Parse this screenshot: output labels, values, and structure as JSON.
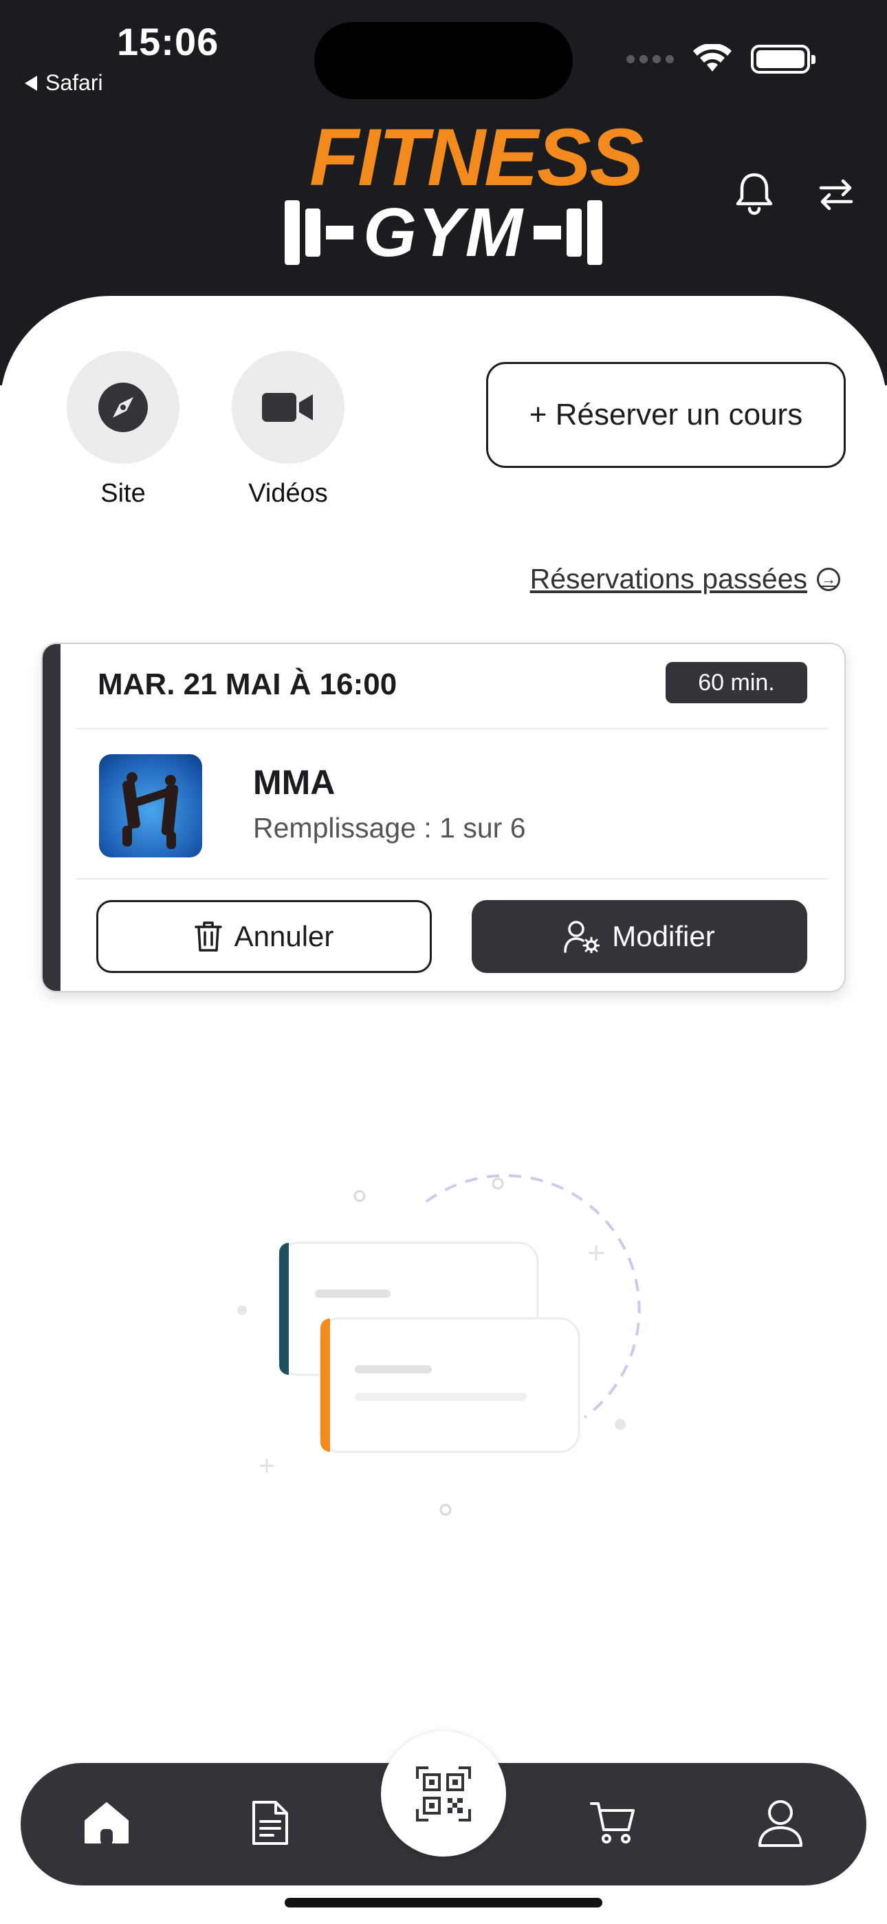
{
  "status_bar": {
    "time": "15:06",
    "back_app": "Safari"
  },
  "header": {
    "logo_top": "FITNESS",
    "logo_bottom": "GYM"
  },
  "quick_actions": [
    {
      "label": "Site",
      "icon": "compass-icon"
    },
    {
      "label": "Vidéos",
      "icon": "video-camera-icon"
    }
  ],
  "reserve_button": "+ Réserver un cours",
  "past_link": "Réservations passées",
  "booking": {
    "date": "MAR. 21 MAI À 16:00",
    "duration": "60 min.",
    "course": "MMA",
    "fill": "Remplissage : 1 sur 6",
    "cancel": "Annuler",
    "modify": "Modifier"
  },
  "tab_bar": {
    "items": [
      "home-icon",
      "document-icon",
      "qr-code-icon",
      "cart-icon",
      "profile-icon"
    ]
  },
  "colors": {
    "header_bg": "#1b1c20",
    "accent_orange": "#f28a1e",
    "dark_button": "#33343a"
  }
}
